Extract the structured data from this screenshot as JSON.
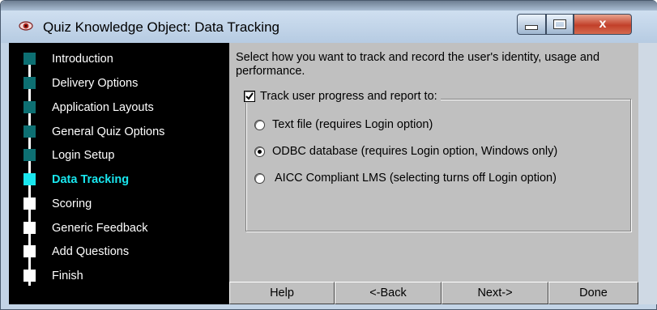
{
  "window": {
    "title": "Quiz Knowledge Object: Data Tracking",
    "close_glyph": "x"
  },
  "sidebar": {
    "items": [
      {
        "label": "Introduction",
        "state": "completed"
      },
      {
        "label": "Delivery Options",
        "state": "completed"
      },
      {
        "label": "Application Layouts",
        "state": "completed"
      },
      {
        "label": "General Quiz Options",
        "state": "completed"
      },
      {
        "label": "Login Setup",
        "state": "completed"
      },
      {
        "label": "Data Tracking",
        "state": "active"
      },
      {
        "label": "Scoring",
        "state": "pending"
      },
      {
        "label": "Generic Feedback",
        "state": "pending"
      },
      {
        "label": "Add Questions",
        "state": "pending"
      },
      {
        "label": "Finish",
        "state": "pending"
      }
    ],
    "colors": {
      "completed": "#0d6f72",
      "active": "#19e6ee",
      "pending": "#ffffff"
    }
  },
  "main": {
    "instructions": "Select how you want to track and record the user's identity, usage and performance.",
    "track_checkbox": {
      "label": "Track user progress and report to:",
      "checked": true
    },
    "options": [
      {
        "label": "Text file (requires Login option)",
        "selected": false
      },
      {
        "label": "ODBC database (requires Login option, Windows only)",
        "selected": true
      },
      {
        "label": "AICC Compliant LMS (selecting turns off Login option)",
        "selected": false
      }
    ]
  },
  "buttons": {
    "help": "Help",
    "back": "<-Back",
    "next": "Next->",
    "done": "Done"
  }
}
